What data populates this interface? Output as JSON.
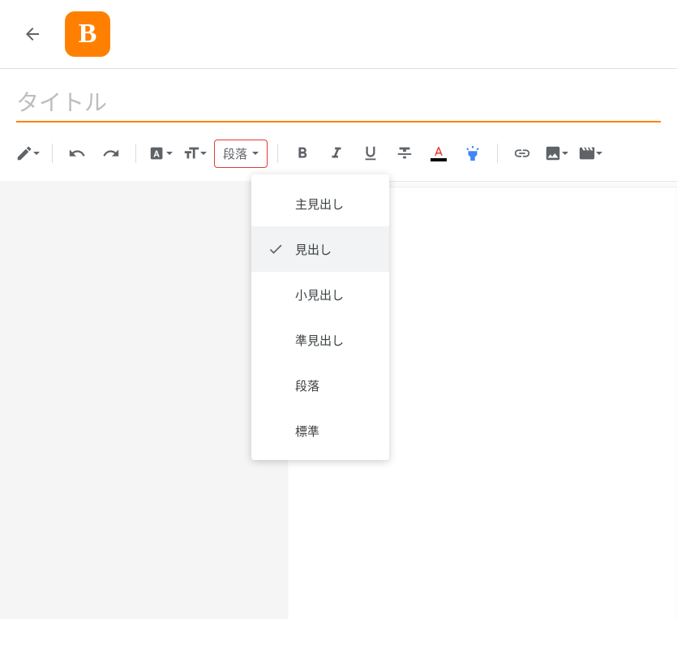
{
  "header": {
    "logo_letter": "B"
  },
  "title": {
    "placeholder": "タイトル"
  },
  "toolbar": {
    "paragraph_label": "段落"
  },
  "dropdown": {
    "items": [
      {
        "label": "主見出し",
        "selected": false
      },
      {
        "label": "見出し",
        "selected": true
      },
      {
        "label": "小見出し",
        "selected": false
      },
      {
        "label": "準見出し",
        "selected": false
      },
      {
        "label": "段落",
        "selected": false
      },
      {
        "label": "標準",
        "selected": false
      }
    ]
  }
}
